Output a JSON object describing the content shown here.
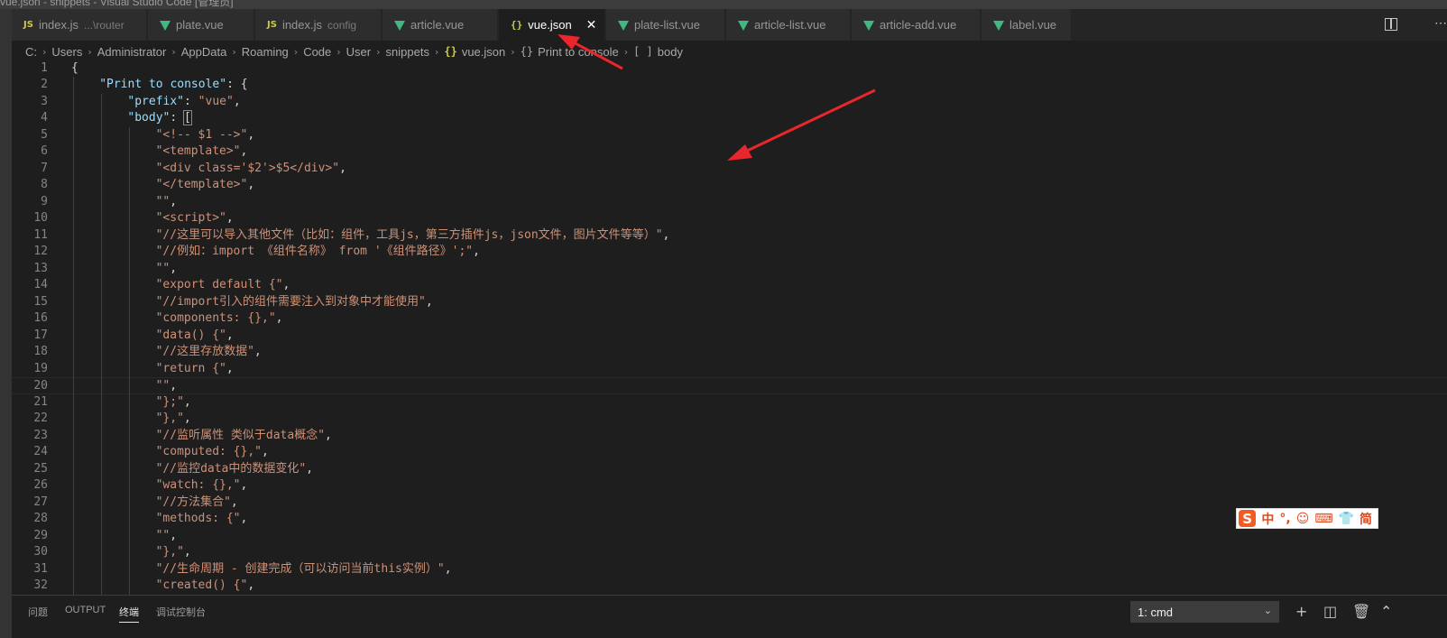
{
  "window": {
    "title_fragment": "vue.json - snippets - Visual Studio Code [管理员]"
  },
  "tabs": [
    {
      "icon": "js-file-icon",
      "icon_text": "JS",
      "label": "index.js",
      "description": "...\\router",
      "active": false
    },
    {
      "icon": "vue-file-icon",
      "icon_text": "",
      "label": "plate.vue",
      "description": "",
      "active": false
    },
    {
      "icon": "js-file-icon",
      "icon_text": "JS",
      "label": "index.js",
      "description": "config",
      "active": false
    },
    {
      "icon": "vue-file-icon",
      "icon_text": "",
      "label": "article.vue",
      "description": "",
      "active": false
    },
    {
      "icon": "json-file-icon",
      "icon_text": "{}",
      "label": "vue.json",
      "description": "",
      "active": true
    },
    {
      "icon": "vue-file-icon",
      "icon_text": "",
      "label": "plate-list.vue",
      "description": "",
      "active": false
    },
    {
      "icon": "vue-file-icon",
      "icon_text": "",
      "label": "article-list.vue",
      "description": "",
      "active": false
    },
    {
      "icon": "vue-file-icon",
      "icon_text": "",
      "label": "article-add.vue",
      "description": "",
      "active": false
    },
    {
      "icon": "vue-file-icon",
      "icon_text": "",
      "label": "label.vue",
      "description": "",
      "active": false
    }
  ],
  "tab_close_glyph": "✕",
  "breadcrumb": {
    "segments": [
      "C:",
      "Users",
      "Administrator",
      "AppData",
      "Roaming",
      "Code",
      "User",
      "snippets"
    ],
    "file_icon": "{}",
    "file": "vue.json",
    "object_icon": "{}",
    "object": "Print to console",
    "array_icon": "[ ]",
    "array": "body",
    "separator": "›"
  },
  "editor": {
    "current_line": 20,
    "lines": [
      {
        "n": "1",
        "indent": 0,
        "tokens": [
          [
            "p",
            "{"
          ]
        ]
      },
      {
        "n": "2",
        "indent": 1,
        "tokens": [
          [
            "k",
            "\"Print to console\""
          ],
          [
            "p",
            ": {"
          ]
        ]
      },
      {
        "n": "3",
        "indent": 2,
        "tokens": [
          [
            "k",
            "\"prefix\""
          ],
          [
            "p",
            ": "
          ],
          [
            "s",
            "\"vue\""
          ],
          [
            "p",
            ","
          ]
        ]
      },
      {
        "n": "4",
        "indent": 2,
        "tokens": [
          [
            "k",
            "\"body\""
          ],
          [
            "p",
            ": "
          ],
          [
            "hl",
            "["
          ]
        ]
      },
      {
        "n": "5",
        "indent": 3,
        "tokens": [
          [
            "s",
            "\"<!-- $1 -->\""
          ],
          [
            "p",
            ","
          ]
        ]
      },
      {
        "n": "6",
        "indent": 3,
        "tokens": [
          [
            "s",
            "\"<template>\""
          ],
          [
            "p",
            ","
          ]
        ]
      },
      {
        "n": "7",
        "indent": 3,
        "tokens": [
          [
            "s",
            "\"<div class='$2'>$5</div>\""
          ],
          [
            "p",
            ","
          ]
        ]
      },
      {
        "n": "8",
        "indent": 3,
        "tokens": [
          [
            "s",
            "\"</template>\""
          ],
          [
            "p",
            ","
          ]
        ]
      },
      {
        "n": "9",
        "indent": 3,
        "tokens": [
          [
            "s",
            "\"\""
          ],
          [
            "p",
            ","
          ]
        ]
      },
      {
        "n": "10",
        "indent": 3,
        "tokens": [
          [
            "s",
            "\"<script>\""
          ],
          [
            "p",
            ","
          ]
        ]
      },
      {
        "n": "11",
        "indent": 3,
        "tokens": [
          [
            "s",
            "\"//这里可以导入其他文件（比如：组件，工具js，第三方插件js，json文件，图片文件等等）\""
          ],
          [
            "p",
            ","
          ]
        ]
      },
      {
        "n": "12",
        "indent": 3,
        "tokens": [
          [
            "s",
            "\"//例如：import 《组件名称》 from '《组件路径》';\""
          ],
          [
            "p",
            ","
          ]
        ]
      },
      {
        "n": "13",
        "indent": 3,
        "tokens": [
          [
            "s",
            "\"\""
          ],
          [
            "p",
            ","
          ]
        ]
      },
      {
        "n": "14",
        "indent": 3,
        "tokens": [
          [
            "s",
            "\"export default {\""
          ],
          [
            "p",
            ","
          ]
        ]
      },
      {
        "n": "15",
        "indent": 3,
        "tokens": [
          [
            "s",
            "\"//import引入的组件需要注入到对象中才能使用\""
          ],
          [
            "p",
            ","
          ]
        ]
      },
      {
        "n": "16",
        "indent": 3,
        "tokens": [
          [
            "s",
            "\"components: {},\""
          ],
          [
            "p",
            ","
          ]
        ]
      },
      {
        "n": "17",
        "indent": 3,
        "tokens": [
          [
            "s",
            "\"data() {\""
          ],
          [
            "p",
            ","
          ]
        ]
      },
      {
        "n": "18",
        "indent": 3,
        "tokens": [
          [
            "s",
            "\"//这里存放数据\""
          ],
          [
            "p",
            ","
          ]
        ]
      },
      {
        "n": "19",
        "indent": 3,
        "tokens": [
          [
            "s",
            "\"return {\""
          ],
          [
            "p",
            ","
          ]
        ]
      },
      {
        "n": "20",
        "indent": 3,
        "tokens": [
          [
            "s",
            "\"\""
          ],
          [
            "p",
            ","
          ]
        ]
      },
      {
        "n": "21",
        "indent": 3,
        "tokens": [
          [
            "s",
            "\"};\""
          ],
          [
            "p",
            ","
          ]
        ]
      },
      {
        "n": "22",
        "indent": 3,
        "tokens": [
          [
            "s",
            "\"},\""
          ],
          [
            "p",
            ","
          ]
        ]
      },
      {
        "n": "23",
        "indent": 3,
        "tokens": [
          [
            "s",
            "\"//监听属性 类似于data概念\""
          ],
          [
            "p",
            ","
          ]
        ]
      },
      {
        "n": "24",
        "indent": 3,
        "tokens": [
          [
            "s",
            "\"computed: {},\""
          ],
          [
            "p",
            ","
          ]
        ]
      },
      {
        "n": "25",
        "indent": 3,
        "tokens": [
          [
            "s",
            "\"//监控data中的数据变化\""
          ],
          [
            "p",
            ","
          ]
        ]
      },
      {
        "n": "26",
        "indent": 3,
        "tokens": [
          [
            "s",
            "\"watch: {},\""
          ],
          [
            "p",
            ","
          ]
        ]
      },
      {
        "n": "27",
        "indent": 3,
        "tokens": [
          [
            "s",
            "\"//方法集合\""
          ],
          [
            "p",
            ","
          ]
        ]
      },
      {
        "n": "28",
        "indent": 3,
        "tokens": [
          [
            "s",
            "\"methods: {\""
          ],
          [
            "p",
            ","
          ]
        ]
      },
      {
        "n": "29",
        "indent": 3,
        "tokens": [
          [
            "s",
            "\"\""
          ],
          [
            "p",
            ","
          ]
        ]
      },
      {
        "n": "30",
        "indent": 3,
        "tokens": [
          [
            "s",
            "\"},\""
          ],
          [
            "p",
            ","
          ]
        ]
      },
      {
        "n": "31",
        "indent": 3,
        "tokens": [
          [
            "s",
            "\"//生命周期 - 创建完成（可以访问当前this实例）\""
          ],
          [
            "p",
            ","
          ]
        ]
      },
      {
        "n": "32",
        "indent": 3,
        "tokens": [
          [
            "s",
            "\"created() {\""
          ],
          [
            "p",
            ","
          ]
        ]
      }
    ]
  },
  "ime_toolbar": {
    "logo": "S",
    "items": [
      "中",
      "°,",
      "☺",
      "⌨",
      "👕",
      "简"
    ]
  },
  "panel": {
    "tabs": [
      {
        "label": "问题",
        "active": false
      },
      {
        "label": "OUTPUT",
        "active": false
      },
      {
        "label": "终端",
        "active": true
      },
      {
        "label": "调试控制台",
        "active": false
      }
    ],
    "terminal_select": "1: cmd",
    "chevron": "⌄",
    "buttons": [
      {
        "name": "new-terminal-icon",
        "glyph": "+"
      },
      {
        "name": "split-terminal-icon",
        "glyph": "◫"
      },
      {
        "name": "trash-icon",
        "glyph": "🗑"
      },
      {
        "name": "chevron-up-icon",
        "glyph": "⌃"
      }
    ]
  },
  "colors": {
    "editor_bg": "#1e1e1e",
    "json_key": "#9cdcfe",
    "json_string": "#ce9178",
    "annotation_arrow": "#e8262b"
  }
}
